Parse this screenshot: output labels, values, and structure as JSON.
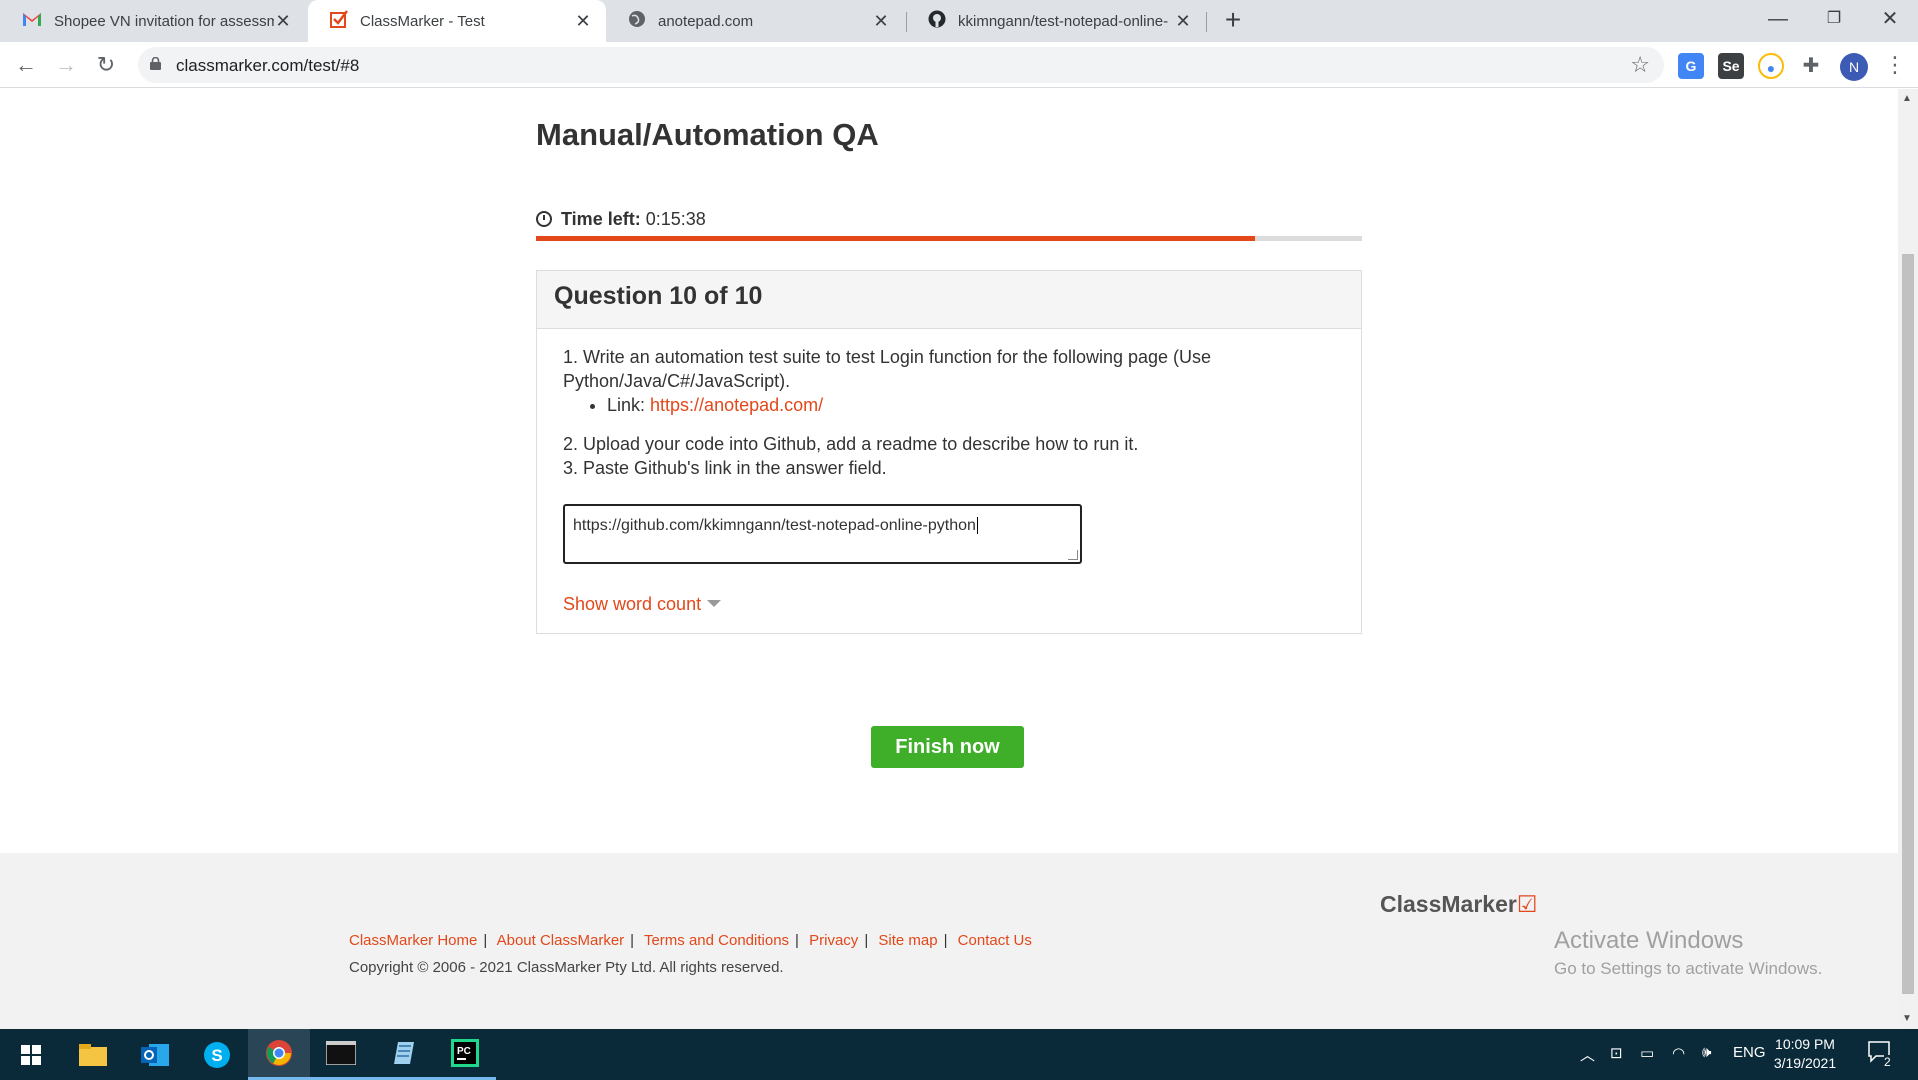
{
  "browser": {
    "tabs": [
      {
        "title": "Shopee VN invitation for assessm",
        "icon": "gmail-icon"
      },
      {
        "title": "ClassMarker - Test",
        "icon": "classmarker-icon"
      },
      {
        "title": "anotepad.com",
        "icon": "globe-icon"
      },
      {
        "title": "kkimngann/test-notepad-online-",
        "icon": "github-icon"
      }
    ],
    "url": "classmarker.com/test/#8",
    "profile_initial": "N"
  },
  "test": {
    "title": "Manual/Automation QA",
    "time_label": "Time left:",
    "time_value": "0:15:38",
    "time_progress_fraction": 0.87,
    "progress_color": "#e2481a"
  },
  "question": {
    "header": "Question 10 of 10",
    "line1": "1. Write an automation test suite to test Login function for the following page (Use Python/Java/C#/JavaScript).",
    "link_label": "Link: ",
    "link_url": "https://anotepad.com/",
    "line2": "2. Upload your code into Github, add a readme to describe how to run it.",
    "line3": "3. Paste Github's link in the answer field.",
    "answer_value": "https://github.com/kkimngann/test-notepad-online-python",
    "word_count_label": "Show word count"
  },
  "actions": {
    "finish_label": "Finish now",
    "accent_color": "#3fae29"
  },
  "footer": {
    "links": [
      "ClassMarker Home",
      "About ClassMarker",
      "Terms and Conditions",
      "Privacy",
      "Site map",
      "Contact Us"
    ],
    "copyright": "Copyright © 2006 - 2021 ClassMarker Pty Ltd. All rights reserved.",
    "logo_text": "ClassMarker",
    "activate_title": "Activate Windows",
    "activate_sub": "Go to Settings to activate Windows."
  },
  "taskbar": {
    "language": "ENG",
    "time": "10:09 PM",
    "date": "3/19/2021",
    "notifications": "2"
  }
}
